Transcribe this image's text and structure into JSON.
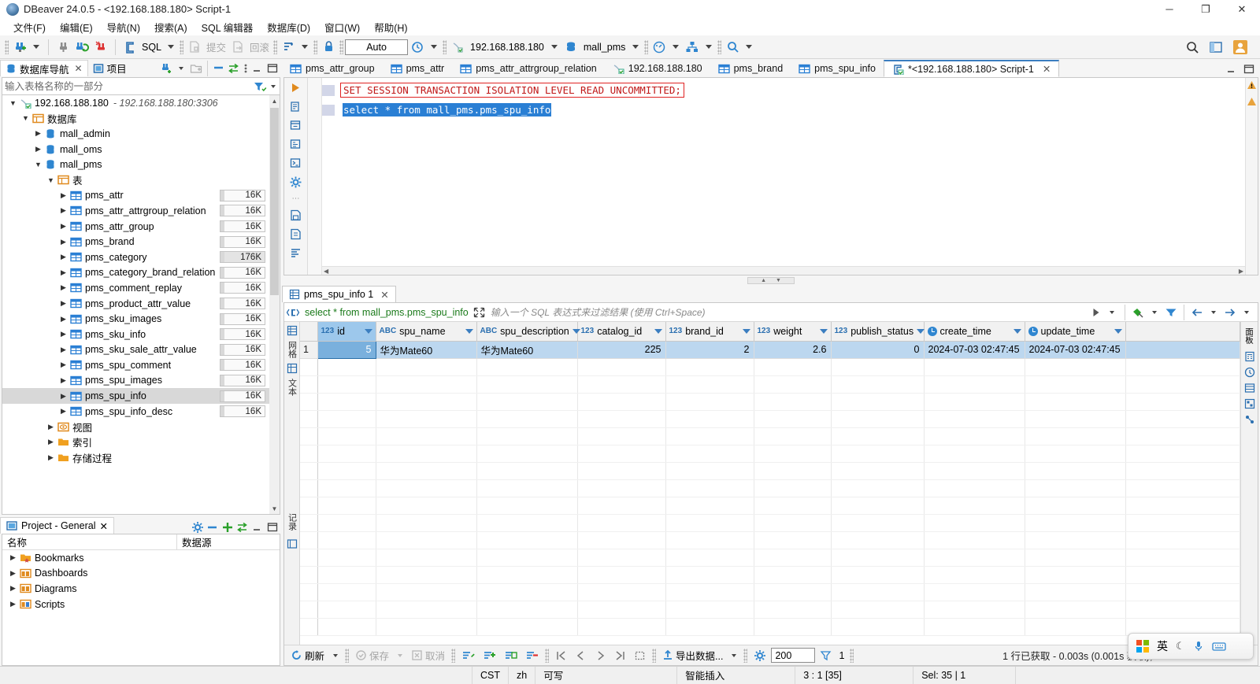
{
  "window": {
    "title": "DBeaver 24.0.5 - <192.168.188.180> Script-1",
    "minimize": "─",
    "maximize": "❐",
    "close": "✕"
  },
  "menu": [
    {
      "label": "文件(F)"
    },
    {
      "label": "编辑(E)"
    },
    {
      "label": "导航(N)"
    },
    {
      "label": "搜索(A)"
    },
    {
      "label": "SQL 编辑器"
    },
    {
      "label": "数据库(D)"
    },
    {
      "label": "窗口(W)"
    },
    {
      "label": "帮助(H)"
    }
  ],
  "toolbar": {
    "sql_label": "SQL",
    "commit_label": "提交",
    "rollback_label": "回滚",
    "auto_label": "Auto",
    "connection": "192.168.188.180",
    "database": "mall_pms"
  },
  "navigator": {
    "tab_label": "数据库导航",
    "tab2_label": "项目",
    "filter_placeholder": "输入表格名称的一部分",
    "tree": [
      {
        "label": "192.168.188.180",
        "sub": "- 192.168.188.180:3306",
        "indent": 0,
        "icon": "connection-icon",
        "expanded": true
      },
      {
        "label": "数据库",
        "indent": 1,
        "icon": "databases-folder-icon",
        "expanded": true
      },
      {
        "label": "mall_admin",
        "indent": 2,
        "icon": "database-icon",
        "expanded": false
      },
      {
        "label": "mall_oms",
        "indent": 2,
        "icon": "database-icon",
        "expanded": false
      },
      {
        "label": "mall_pms",
        "indent": 2,
        "icon": "database-icon",
        "expanded": true
      },
      {
        "label": "表",
        "indent": 3,
        "icon": "tables-folder-icon",
        "expanded": true
      },
      {
        "label": "pms_attr",
        "indent": 4,
        "icon": "table-icon",
        "size": "16K"
      },
      {
        "label": "pms_attr_attrgroup_relation",
        "indent": 4,
        "icon": "table-icon",
        "size": "16K"
      },
      {
        "label": "pms_attr_group",
        "indent": 4,
        "icon": "table-icon",
        "size": "16K"
      },
      {
        "label": "pms_brand",
        "indent": 4,
        "icon": "table-icon",
        "size": "16K"
      },
      {
        "label": "pms_category",
        "indent": 4,
        "icon": "table-icon",
        "size": "176K",
        "big": true
      },
      {
        "label": "pms_category_brand_relation",
        "indent": 4,
        "icon": "table-icon",
        "size": "16K"
      },
      {
        "label": "pms_comment_replay",
        "indent": 4,
        "icon": "table-icon",
        "size": "16K"
      },
      {
        "label": "pms_product_attr_value",
        "indent": 4,
        "icon": "table-icon",
        "size": "16K"
      },
      {
        "label": "pms_sku_images",
        "indent": 4,
        "icon": "table-icon",
        "size": "16K"
      },
      {
        "label": "pms_sku_info",
        "indent": 4,
        "icon": "table-icon",
        "size": "16K"
      },
      {
        "label": "pms_sku_sale_attr_value",
        "indent": 4,
        "icon": "table-icon",
        "size": "16K"
      },
      {
        "label": "pms_spu_comment",
        "indent": 4,
        "icon": "table-icon",
        "size": "16K"
      },
      {
        "label": "pms_spu_images",
        "indent": 4,
        "icon": "table-icon",
        "size": "16K"
      },
      {
        "label": "pms_spu_info",
        "indent": 4,
        "icon": "table-icon",
        "size": "16K",
        "selected": true
      },
      {
        "label": "pms_spu_info_desc",
        "indent": 4,
        "icon": "table-icon",
        "size": "16K"
      },
      {
        "label": "视图",
        "indent": 3,
        "icon": "views-folder-icon"
      },
      {
        "label": "索引",
        "indent": 3,
        "icon": "folder-icon"
      },
      {
        "label": "存储过程",
        "indent": 3,
        "icon": "folder-icon"
      }
    ]
  },
  "project": {
    "tab_label": "Project - General",
    "col_name": "名称",
    "col_datasource": "数据源",
    "items": [
      {
        "label": "Bookmarks",
        "icon": "bookmark-folder-icon"
      },
      {
        "label": "Dashboards",
        "icon": "dashboard-icon"
      },
      {
        "label": "Diagrams",
        "icon": "diagram-icon"
      },
      {
        "label": "Scripts",
        "icon": "scripts-icon"
      }
    ]
  },
  "editor": {
    "tabs": [
      {
        "label": "pms_attr_group",
        "icon": "table-icon",
        "active": false
      },
      {
        "label": "pms_attr",
        "icon": "table-icon",
        "active": false
      },
      {
        "label": "pms_attr_attrgroup_relation",
        "icon": "table-icon",
        "active": false
      },
      {
        "label": "192.168.188.180",
        "icon": "connection-icon",
        "active": false
      },
      {
        "label": "pms_brand",
        "icon": "table-icon",
        "active": false
      },
      {
        "label": "pms_spu_info",
        "icon": "table-icon",
        "active": false
      },
      {
        "label": "*<192.168.188.180> Script-1",
        "icon": "sql-script-icon",
        "active": true
      }
    ],
    "lines": [
      {
        "text": "SET SESSION TRANSACTION ISOLATION LEVEL READ UNCOMMITTED;",
        "style": "highlighted-error"
      },
      {
        "text": "select * from mall_pms.pms_spu_info",
        "style": "selected"
      }
    ]
  },
  "results": {
    "tab_label": "pms_spu_info 1",
    "filter_query": "select * from mall_pms.pms_spu_info",
    "filter_placeholder": "输入一个 SQL 表达式来过滤结果 (使用 Ctrl+Space)",
    "left_tabs": [
      "网格",
      "文本"
    ],
    "left_tab_extra": "记录",
    "columns": [
      {
        "name": "id",
        "type": "123",
        "type_icon": "number-key-icon"
      },
      {
        "name": "spu_name",
        "type": "ABC",
        "type_icon": "text-icon"
      },
      {
        "name": "spu_description",
        "type": "ABC",
        "type_icon": "text-icon"
      },
      {
        "name": "catalog_id",
        "type": "123",
        "type_icon": "number-icon"
      },
      {
        "name": "brand_id",
        "type": "123",
        "type_icon": "number-icon"
      },
      {
        "name": "weight",
        "type": "123",
        "type_icon": "number-icon"
      },
      {
        "name": "publish_status",
        "type": "123",
        "type_icon": "number-icon"
      },
      {
        "name": "create_time",
        "type": "clock",
        "type_icon": "datetime-icon"
      },
      {
        "name": "update_time",
        "type": "clock",
        "type_icon": "datetime-icon"
      }
    ],
    "rows": [
      {
        "num": "1",
        "cells": [
          "5",
          "华为Mate60",
          "华为Mate60",
          "225",
          "2",
          "2.6",
          "0",
          "2024-07-03 02:47:45",
          "2024-07-03 02:47:45"
        ]
      }
    ],
    "footer": {
      "refresh": "刷新",
      "save": "保存",
      "cancel": "取消",
      "export": "导出数据...",
      "fetch_size": "200",
      "page": "1",
      "status": "1 行已获取 - 0.003s (0.001s 获取), 2024-07-03 02:48:05"
    }
  },
  "statusbar": {
    "encoding": "CST",
    "locale": "zh",
    "writable": "可写",
    "insert_mode": "智能插入",
    "position": "3 : 1 [35]",
    "selection": "Sel: 35 | 1"
  },
  "ime": {
    "lang": "英",
    "moon": "☾",
    "mic": "🎤",
    "keyboard": "⌨"
  },
  "colors": {
    "accent": "#2a7fd4",
    "error_box": "#e02222",
    "keyword": "#3030c0",
    "sql_red": "#c01818",
    "grid_row": "#bcd7ef",
    "header_active": "#9dc8ec"
  }
}
